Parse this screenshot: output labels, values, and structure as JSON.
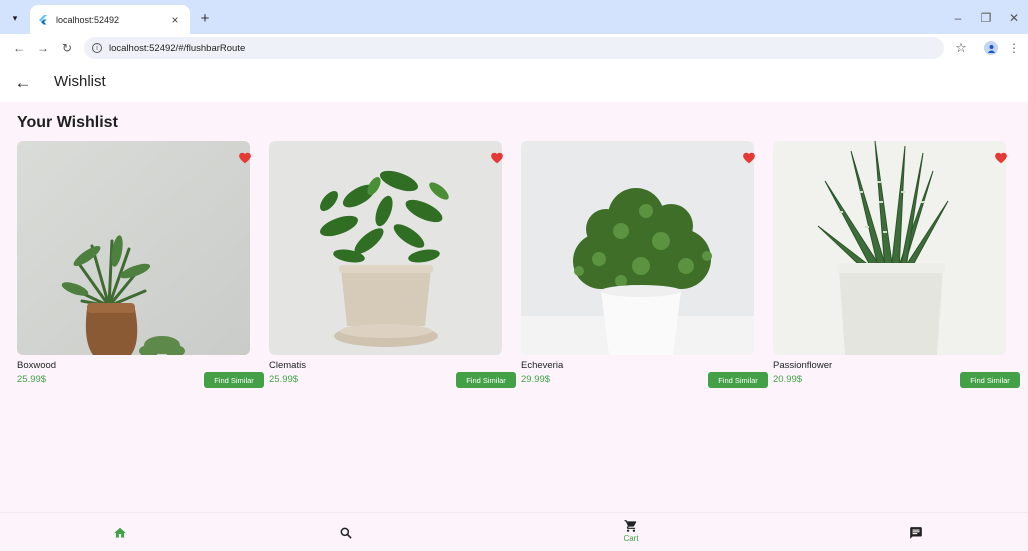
{
  "browser": {
    "tab_title": "localhost:52492",
    "tab_close": "×",
    "new_tab": "+",
    "url": "localhost:52492/#/flushbarRoute"
  },
  "app": {
    "title": "Wishlist",
    "section_title": "Your Wishlist"
  },
  "products": [
    {
      "name": "Boxwood",
      "price": "25.99$",
      "button": "Find Similar",
      "favorited": true
    },
    {
      "name": "Clematis",
      "price": "25.99$",
      "button": "Find Similar",
      "favorited": true
    },
    {
      "name": "Echeveria",
      "price": "29.99$",
      "button": "Find Similar",
      "favorited": true
    },
    {
      "name": "Passionflower",
      "price": "20.99$",
      "button": "Find Similar",
      "favorited": true
    }
  ],
  "bottom_nav": {
    "items": [
      {
        "icon": "home-icon",
        "label": ""
      },
      {
        "icon": "search-icon",
        "label": ""
      },
      {
        "icon": "cart-icon",
        "label": "Cart"
      },
      {
        "icon": "chat-icon",
        "label": ""
      }
    ]
  },
  "colors": {
    "accent": "#43a047",
    "heart": "#e53935",
    "background": "#fdf4fb"
  }
}
